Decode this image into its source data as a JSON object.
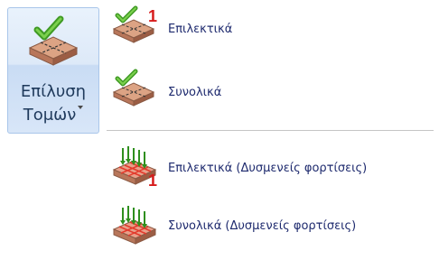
{
  "ribbon_button": {
    "line1": "Επίλυση",
    "line2": "Τομών",
    "icon": "slab-check-icon",
    "has_dropdown": true
  },
  "menu": {
    "items": [
      {
        "label": "Επιλεκτικά",
        "icon": "slab-check-one-icon",
        "badge": "1"
      },
      {
        "label": "Συνολικά",
        "icon": "slab-check-icon"
      },
      {
        "label": "Επιλεκτικά  (Δυσμενείς φορτίσεις)",
        "icon": "slab-loads-one-icon",
        "badge": "1"
      },
      {
        "label": "Συνολικά  (Δυσμενείς φορτίσεις)",
        "icon": "slab-loads-icon"
      }
    ]
  },
  "colors": {
    "check_green": "#3f9a24",
    "slab_top": "#d9a07e",
    "slab_side": "#a8684a",
    "badge_red": "#d71b1b",
    "grid_red": "#e23a2c",
    "label_text": "#1e2a6e"
  }
}
